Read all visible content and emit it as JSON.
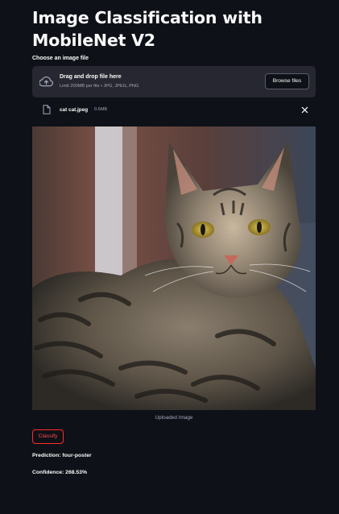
{
  "app": {
    "title": "Image Classification with MobileNet V2"
  },
  "uploader": {
    "label": "Choose an image file",
    "drop_title": "Drag and drop file here",
    "drop_subtitle": "Limit 200MB per file • JPG, JPEG, PNG",
    "browse_label": "Browse files",
    "icon": "cloud-upload-icon"
  },
  "file": {
    "name": "cat cat.jpeg",
    "size": "0.6MB",
    "icon": "file-icon",
    "remove_icon": "close-icon"
  },
  "image": {
    "caption": "Uploaded Image"
  },
  "classify": {
    "label": "Classify"
  },
  "results": {
    "prediction": "Prediction: four-poster",
    "confidence": "Confidence: 268.53%"
  },
  "colors": {
    "background": "#0e1117",
    "surface": "#262730",
    "accent": "#ff4b4b",
    "muted_text": "#a3a8b8"
  }
}
